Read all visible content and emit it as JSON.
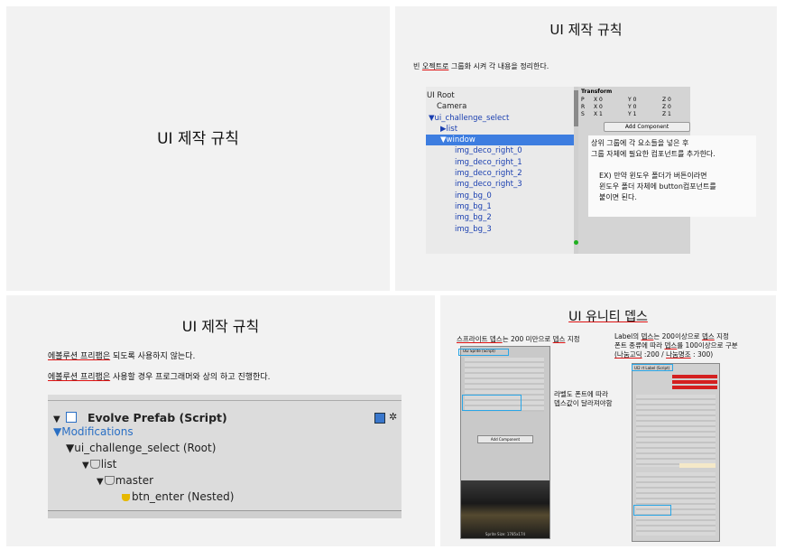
{
  "slide1": {
    "title": "UI 제작 규칙"
  },
  "slide2": {
    "title": "UI 제작 규칙",
    "subtitle_pre": "빈 ",
    "subtitle_ul": "오젝트로",
    "subtitle_post": " 그룹화 시켜 각 내용을 정리한다.",
    "hierarchy": [
      "UI Root",
      "Camera",
      "▼ui_challenge_select",
      "▶list",
      "▼window",
      "img_deco_right_0",
      "img_deco_right_1",
      "img_deco_right_2",
      "img_deco_right_3",
      "img_bg_0",
      "img_bg_1",
      "img_bg_2",
      "img_bg_3"
    ],
    "transform_label": "Transform",
    "transform_rows": [
      {
        "p": "P",
        "x": "X 0",
        "y": "Y 0",
        "z": "Z 0"
      },
      {
        "p": "R",
        "x": "X 0",
        "y": "Y 0",
        "z": "Z 0"
      },
      {
        "p": "S",
        "x": "X 1",
        "y": "Y 1",
        "z": "Z 1"
      }
    ],
    "add_component": "Add Component",
    "note1_line1": "상위 그룹에 각 요소들을 넣은 후",
    "note1_line2": "그룹 자체에 필요한 컴포넌트를 추가한다.",
    "note2_line1": "EX) 만약 윈도우 폴더가 버튼이라면",
    "note2_line2": "윈도우 폴더 자체에 button컴포넌트를",
    "note2_line3": "붙이면 된다."
  },
  "slide3": {
    "title": "UI  제작 규칙",
    "line1_ul": "에볼루션 프리팹은",
    "line1_post": " 되도록 사용하지 않는다.",
    "line2_ul": "에볼루션 프리팹은",
    "line2_post": " 사용할 경우 프로그래머와 상의 하고 진행한다.",
    "component": "Evolve Prefab (Script)",
    "modifications": "▼Modifications",
    "tree": [
      "▼ui_challenge_select (Root)",
      "list",
      "master",
      "btn_enter (Nested)"
    ]
  },
  "slide4": {
    "title": "UI 유니티 뎁스",
    "left_caption_ul": "스프라이트 뎁스",
    "left_caption_post": "는 200 미만으로 ",
    "left_caption_ul2": "뎁스",
    "left_caption_post2": " 지정",
    "right_caption_l1_a": "Label의 ",
    "right_caption_l1_ul": "뎁스",
    "right_caption_l1_b": "는 200이상으로 ",
    "right_caption_l1_ul2": "뎁스",
    "right_caption_l1_c": " 지정",
    "right_caption_l2_a": "폰트 종류에 따라 ",
    "right_caption_l2_ul": "뎁스",
    "right_caption_l2_b": "를 100이상으로 구분",
    "right_caption_l3_ul": "(나눔고딕",
    "right_caption_l3_b": " :200 / ",
    "right_caption_l3_ul2": "나눔명조",
    "right_caption_l3_c": " : 300)",
    "middle_note_l1": "라벨도 폰트에 따라",
    "middle_note_l2": "뎁스값이 달라져야함",
    "left_component": "UI2 Sprite (Script)",
    "right_component": "UI2 rt Label (Script)",
    "left_add": "Add Component",
    "left_footer": "Sprite Size: 1785x174"
  }
}
